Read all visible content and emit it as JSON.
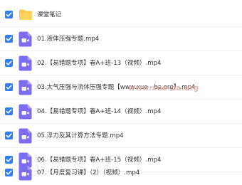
{
  "file_list": {
    "folder": {
      "name": "课堂笔记",
      "checked": true,
      "icon": "folder-icon",
      "icon_color": "#f7c948"
    },
    "files": [
      {
        "name": "01.液体压强专题.mp4",
        "checked": true,
        "icon": "video-file-icon"
      },
      {
        "name": "02.【易错题专项】春A+班-13（视频）.mp4",
        "checked": true,
        "icon": "video-file-icon"
      },
      {
        "name": "03.大气压强与流体压强专题【www.xue - ba.org】.mp4",
        "checked": true,
        "icon": "video-file-icon"
      },
      {
        "name": "04.【易错题专项】春A+班-14（视频）.mp4",
        "checked": true,
        "icon": "video-file-icon"
      },
      {
        "name": "05.浮力及其计算方法专题.mp4",
        "checked": true,
        "icon": "video-file-icon"
      },
      {
        "name": "06.【易错题专项】春A+班-15（视频）.mp4",
        "checked": true,
        "icon": "video-file-icon"
      },
      {
        "name": "07.【月度复习课】（2）（视频）.mp4",
        "checked": true,
        "icon": "video-file-icon"
      }
    ],
    "colors": {
      "checkbox": "#2f7ef5",
      "video_icon": "#7b6cf0",
      "text": "#333333"
    }
  },
  "watermark": {
    "text": "www.xue-ba.org"
  }
}
